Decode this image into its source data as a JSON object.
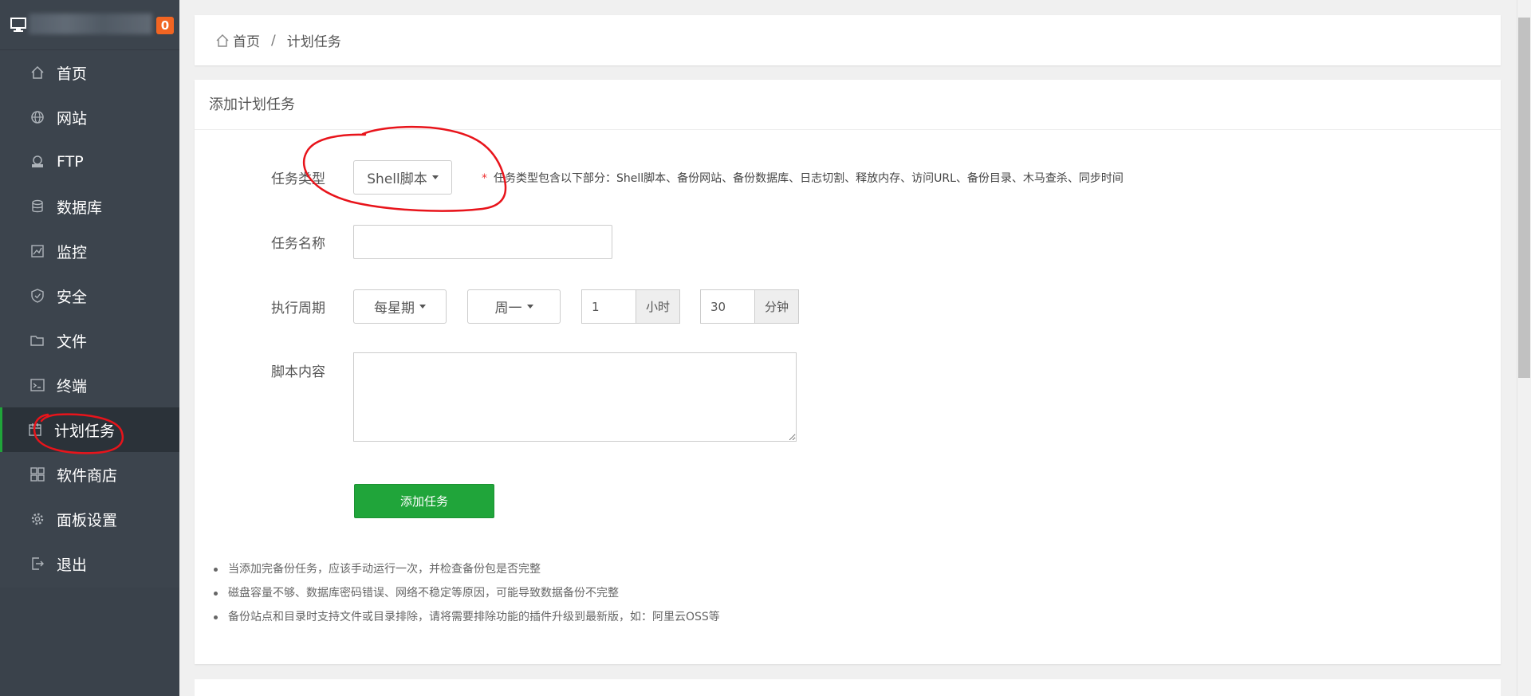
{
  "sidebar": {
    "notice_count": "0",
    "items": [
      {
        "label": "首页",
        "icon": "home-icon"
      },
      {
        "label": "网站",
        "icon": "globe-icon"
      },
      {
        "label": "FTP",
        "icon": "ftp-icon"
      },
      {
        "label": "数据库",
        "icon": "database-icon"
      },
      {
        "label": "监控",
        "icon": "monitor-chart-icon"
      },
      {
        "label": "安全",
        "icon": "shield-icon"
      },
      {
        "label": "文件",
        "icon": "folder-icon"
      },
      {
        "label": "终端",
        "icon": "terminal-icon"
      },
      {
        "label": "计划任务",
        "icon": "calendar-icon",
        "active": true
      },
      {
        "label": "软件商店",
        "icon": "grid-icon"
      },
      {
        "label": "面板设置",
        "icon": "gear-icon"
      },
      {
        "label": "退出",
        "icon": "logout-icon"
      }
    ]
  },
  "breadcrumb": {
    "home": "首页",
    "separator": "/",
    "current": "计划任务"
  },
  "panel": {
    "title": "添加计划任务",
    "task_type": {
      "label": "任务类型",
      "value": "Shell脚本",
      "hint_star": "*",
      "hint": "任务类型包含以下部分：Shell脚本、备份网站、备份数据库、日志切割、释放内存、访问URL、备份目录、木马查杀、同步时间"
    },
    "task_name": {
      "label": "任务名称",
      "value": ""
    },
    "cycle": {
      "label": "执行周期",
      "period": "每星期",
      "weekday": "周一",
      "hour_value": "1",
      "hour_unit": "小时",
      "minute_value": "30",
      "minute_unit": "分钟"
    },
    "script": {
      "label": "脚本内容",
      "value": ""
    },
    "submit_label": "添加任务",
    "notes": [
      "当添加完备份任务，应该手动运行一次，并检查备份包是否完整",
      "磁盘容量不够、数据库密码错误、网络不稳定等原因，可能导致数据备份不完整",
      "备份站点和目录时支持文件或目录排除，请将需要排除功能的插件升级到最新版，如：阿里云OSS等"
    ]
  },
  "colors": {
    "sidebar_bg": "#3c444d",
    "active_accent": "#20a53a",
    "primary_button": "#20a53a",
    "badge": "#f26522",
    "annotation": "#e8141b"
  }
}
